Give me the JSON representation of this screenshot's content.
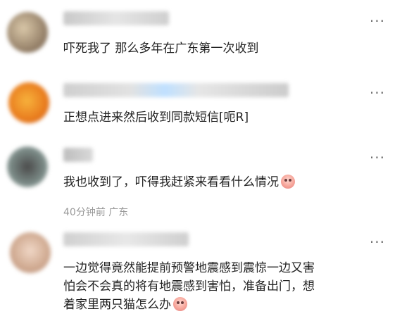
{
  "comments": [
    {
      "text": "吓死我了 那么多年在广东第一次收到",
      "more": "···"
    },
    {
      "text": "正想点进来然后收到同款短信[呃R]",
      "more": "···"
    },
    {
      "text": "我也收到了，吓得我赶紧来看看什么情况",
      "more": "···",
      "time": "40分钟前",
      "location": "广东"
    },
    {
      "text_line1": "一边觉得竟然能提前预警地震感到震惊一边又害",
      "text_line2": "怕会不会真的将有地震感到害怕，准备出门，想",
      "text_line3": "着家里两只猫怎么办",
      "more": "···"
    }
  ],
  "icons": {
    "emoji": "crying-face-emoji",
    "more": "more-options-icon"
  }
}
